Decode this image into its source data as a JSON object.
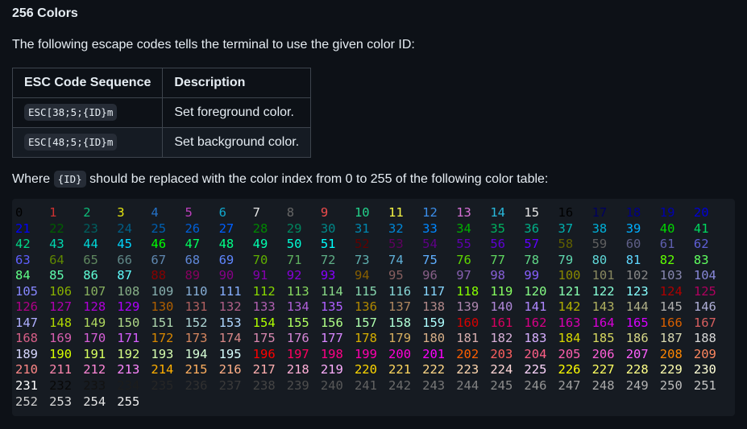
{
  "section": {
    "heading": "256 Colors",
    "intro": "The following escape codes tells the terminal to use the given color ID:"
  },
  "table": {
    "headers": [
      "ESC Code Sequence",
      "Description"
    ],
    "rows": [
      {
        "code": "ESC[38;5;{ID}m",
        "description": "Set foreground color."
      },
      {
        "code": "ESC[48;5;{ID}m",
        "description": "Set background color."
      }
    ]
  },
  "where": {
    "prefix": "Where",
    "code": "{ID}",
    "suffix": "should be replaced with the color index from 0 to 255 of the following color table:"
  },
  "palette": {
    "range": [
      0,
      255
    ],
    "per_row": 21,
    "colors": {
      "base16": [
        "#000000",
        "#cd3131",
        "#0dbc79",
        "#e5e510",
        "#2472c8",
        "#bc3fbc",
        "#11a8cd",
        "#e5e5e5",
        "#666666",
        "#f14c4c",
        "#23d18b",
        "#f5f543",
        "#3b8eea",
        "#d670d6",
        "#29b8db",
        "#e5e5e5"
      ],
      "cube_levels": [
        "#00",
        "#5f",
        "#87",
        "#af",
        "#d7",
        "#ff"
      ],
      "grayscale_start": 8,
      "grayscale_step": 10
    }
  }
}
